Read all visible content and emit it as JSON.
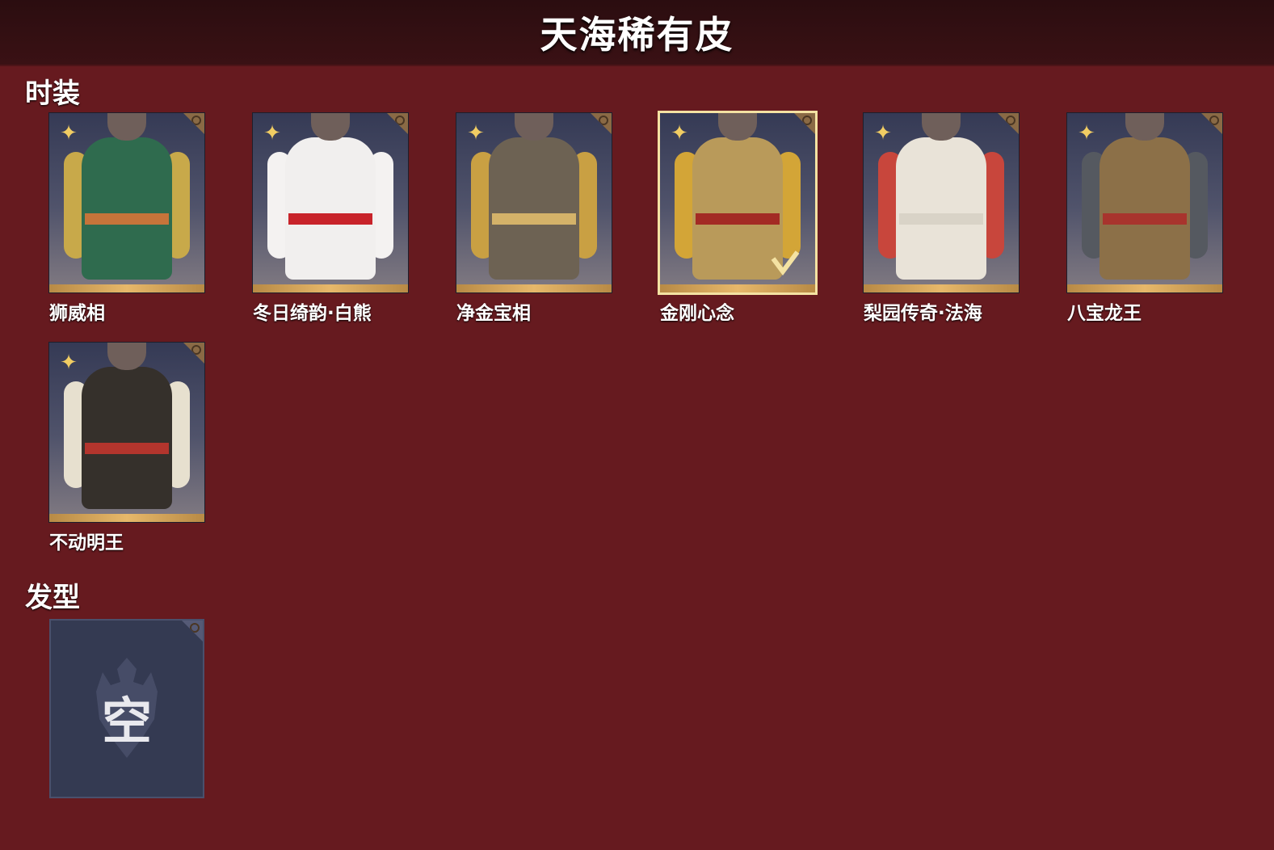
{
  "title": "天海稀有皮",
  "sections": {
    "outfits": {
      "title": "时装",
      "items": [
        {
          "name": "狮威相",
          "palette": {
            "torso": "#2f6b4e",
            "arm": "#c8a94a",
            "belt": "#c6743a"
          }
        },
        {
          "name": "冬日绮韵·白熊",
          "palette": {
            "torso": "#f1efee",
            "arm": "#f4f2f1",
            "belt": "#c8232a"
          }
        },
        {
          "name": "净金宝相",
          "palette": {
            "torso": "#6d6253",
            "arm": "#c9a043",
            "belt": "#d4b269"
          }
        },
        {
          "name": "金刚心念",
          "selected": true,
          "palette": {
            "torso": "#b99a5a",
            "arm": "#d3a537",
            "belt": "#a32a24"
          }
        },
        {
          "name": "梨园传奇·法海",
          "palette": {
            "torso": "#e9e3d8",
            "arm": "#c8463c",
            "belt": "#d9d3c7"
          }
        },
        {
          "name": "八宝龙王",
          "palette": {
            "torso": "#8c7048",
            "arm": "#555960",
            "belt": "#a8342d"
          }
        },
        {
          "name": "不动明王",
          "palette": {
            "torso": "#35302b",
            "arm": "#e7e0cf",
            "belt": "#b3352d"
          }
        }
      ]
    },
    "hairstyles": {
      "title": "发型",
      "empty_label": "空"
    }
  },
  "icons": {
    "rarity": "four-point-star-icon",
    "corner": "corner-badge-icon",
    "equipped": "check-icon",
    "empty": "warrior-emblem-icon"
  },
  "colors": {
    "background": "#661a1f",
    "header": "#2f0e11",
    "rarity_bar": "#e7b86a",
    "star": "#f1cd63",
    "selected_border": "#f4e2a2"
  }
}
